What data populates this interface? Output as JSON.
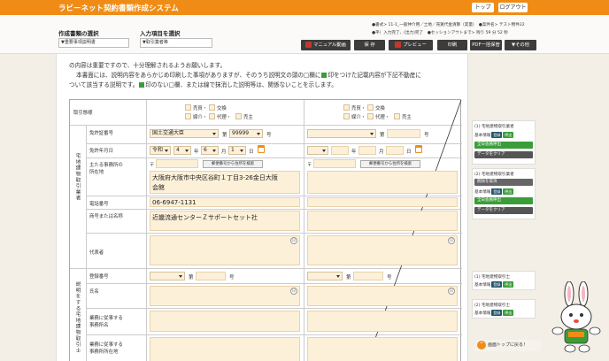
{
  "header": {
    "title": "ラビーネット契約書類作成システム",
    "top_button": "トップ",
    "logout_button": "ログアウト"
  },
  "toolbar": {
    "doc_type_label": "作成書類の選択",
    "doc_type_value": "▼重要事項説明書",
    "input_item_label": "入力項目を選択",
    "input_item_value": "▼取引業者等",
    "info_line1": "●書式> 11-1_一般仲介用／土地／売買代金清算（実量）　●案件名> テスト物件22",
    "info_line2": "●平）入力完了、(出力)完了　●セッションアウトまで> 残り 59 分 52 秒",
    "manual_button": "マニュアル動画",
    "save_button": "保 存",
    "preview_button": "プレビュー",
    "print_button": "印刷",
    "pdf_button": "PDF一括保管",
    "other_button": "▼その他"
  },
  "intro": {
    "line1": "の内容は重要ですので、十分理解されるようお願いします。",
    "line2": "本書面には、説明内容をあらかじめ印刷した事項がありますが、そのうち説明文の頭の□欄に",
    "line2b": "印をつけた記載内容が下記不動産に",
    "line3": "ついて該当する説明です。",
    "line3b": "印のない□欄、または線で抹消した説明等は、関係ないことを示します。"
  },
  "form": {
    "torihiki_label": "取引態様",
    "opt_baibai": "売買・",
    "opt_koukan": "交換",
    "opt_baikai": "媒介・",
    "opt_dairi": "代理・",
    "opt_urinushi": "売主",
    "section1_label": "宅地建物取引業者",
    "license_no_label": "免許証番号",
    "license_issuer": "国土交通大臣",
    "license_dai": "第",
    "license_number": "99999",
    "license_go": "号",
    "license_date_label": "免許年月日",
    "era": "令和",
    "year": "4",
    "nen": "年",
    "month": "6",
    "tsuki": "月",
    "day": "1",
    "hi": "日",
    "office_label1": "主たる事務所の",
    "office_label2": "所在地",
    "postal_mark": "〒",
    "address_search_button": "郵便番号から住所を検索",
    "address1": "大阪府大阪市中央区谷町１丁目3-26金日大阪",
    "address2": "会館",
    "phone_label": "電話番号",
    "phone": "06-6947-1131",
    "name_label": "商号または名称",
    "company_name": "近畿流通センターＺサポートセット社",
    "rep_label": "代表者",
    "seal": "印",
    "section2_label": "説明をする宅地建物取引士",
    "reg_no_label": "登録番号",
    "name2_label": "氏名",
    "office_work_label1": "業務に従事する",
    "office_work_label2": "事務所名",
    "office_addr_label1": "業務に従事する",
    "office_addr_label2": "事務所所在地"
  },
  "side": {
    "p1_title": "(1) 宅地建物取引業者",
    "basic_info": "基本情報",
    "register_btn": "登録",
    "call_btn": "呼出",
    "all_out_btn": "全日会員呼出",
    "clear_btn": "データをクリア",
    "p2_title": "(2) 宅地建物取引業者",
    "p2_select": "削除を取消",
    "p3_title": "(1) 宅地建物取引士",
    "p4_title": "(2) 宅地建物取引士",
    "back_top": "画面トップに戻る！"
  }
}
